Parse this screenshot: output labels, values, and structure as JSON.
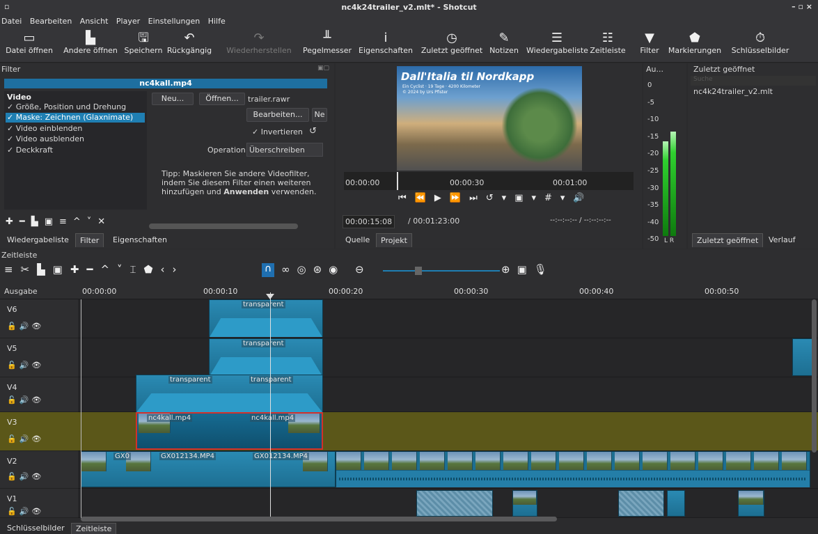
{
  "window": {
    "title": "nc4k24trailer_v2.mlt* - Shotcut",
    "controls": "–  ▫  ×"
  },
  "menu": [
    "Datei",
    "Bearbeiten",
    "Ansicht",
    "Player",
    "Einstellungen",
    "Hilfe"
  ],
  "toolbar": [
    {
      "label": "Datei öffnen",
      "icon": "folder-icon"
    },
    {
      "label": "Andere öffnen",
      "icon": "open-other-icon"
    },
    {
      "label": "Speichern",
      "icon": "save-icon"
    },
    {
      "label": "Rückgängig",
      "icon": "undo-icon"
    },
    {
      "label": "Wiederherstellen",
      "icon": "redo-icon"
    },
    {
      "label": "Pegelmesser",
      "icon": "meter-icon"
    },
    {
      "label": "Eigenschaften",
      "icon": "info-icon"
    },
    {
      "label": "Zuletzt geöffnet",
      "icon": "clock-icon"
    },
    {
      "label": "Notizen",
      "icon": "notes-icon"
    },
    {
      "label": "Wiedergabeliste",
      "icon": "list-icon"
    },
    {
      "label": "Zeitleiste",
      "icon": "timeline-icon"
    },
    {
      "label": "Filter",
      "icon": "filter-icon"
    },
    {
      "label": "Markierungen",
      "icon": "marker-icon"
    },
    {
      "label": "Schlüsselbilder",
      "icon": "stopwatch-icon"
    }
  ],
  "filter_panel": {
    "title": "Filter",
    "clip": "nc4kall.mp4",
    "group": "Video",
    "items": [
      "Größe, Position und Drehung",
      "Maske: Zeichnen (Glaxnimate)",
      "Video einblenden",
      "Video ausblenden",
      "Deckkraft"
    ],
    "selected_index": 1,
    "new_btn": "Neu...",
    "open_btn": "Öffnen...",
    "file": "trailer.rawr",
    "edit_btn": "Bearbeiten...",
    "ne_btn": "Ne",
    "invert_label": "Invertieren",
    "operation_label": "Operation",
    "operation_value": "Überschreiben",
    "tip": "Tipp: Maskieren Sie andere Videofilter, indem Sie diesem Filter einen weiteren hinzufügen und",
    "tip_bold": "Anwenden",
    "tip_end": "verwenden.",
    "tabs": [
      "Wiedergabeliste",
      "Filter",
      "Eigenschaften"
    ]
  },
  "player": {
    "video_title": "Dall'Italia til Nordkapp",
    "video_sub1": "Ein Cyclist · 19 Tage · 4200 Kilometer",
    "video_sub2": "© 2024 by Urs Pfister",
    "ruler": [
      "00:00:00",
      "00:00:30",
      "00:01:00"
    ],
    "timecode": "00:00:15:08",
    "duration": "/ 00:01:23:00",
    "inout": "--:--:--:-- / --:--:--:--",
    "tabs": [
      "Quelle",
      "Projekt"
    ]
  },
  "meter": {
    "title": "Au...",
    "scale": [
      "0",
      "-5",
      "-10",
      "-15",
      "-20",
      "-25",
      "-30",
      "-35",
      "-40",
      "-50"
    ],
    "l": "L",
    "r": "R"
  },
  "recent": {
    "title": "Zuletzt geöffnet",
    "search": "Suche",
    "items": [
      "nc4k24trailer_v2.mlt"
    ],
    "tabs": [
      "Zuletzt geöffnet",
      "Verlauf"
    ]
  },
  "timeline": {
    "title": "Zeitleiste",
    "output": "Ausgabe",
    "ruler": [
      "00:00:00",
      "00:00:10",
      "00:00:20",
      "00:00:30",
      "00:00:40",
      "00:00:50"
    ],
    "tracks": [
      "V6",
      "V5",
      "V4",
      "V3",
      "V2",
      "V1"
    ],
    "clips": {
      "v6": "transparent",
      "v5": "transparent",
      "v4a": "transparent",
      "v4b": "transparent",
      "v3a": "nc4kall.mp4",
      "v3b": "nc4kall.mp4",
      "v2a": "GX0",
      "v2b": "GX012134.MP4",
      "v2c": "GX012134.MP4"
    },
    "bottom_tabs": [
      "Schlüsselbilder",
      "Zeitleiste"
    ]
  },
  "colors": {
    "accent": "#2a8ab3",
    "selected_track": "#5b5719",
    "meter": "#2fd12f"
  }
}
